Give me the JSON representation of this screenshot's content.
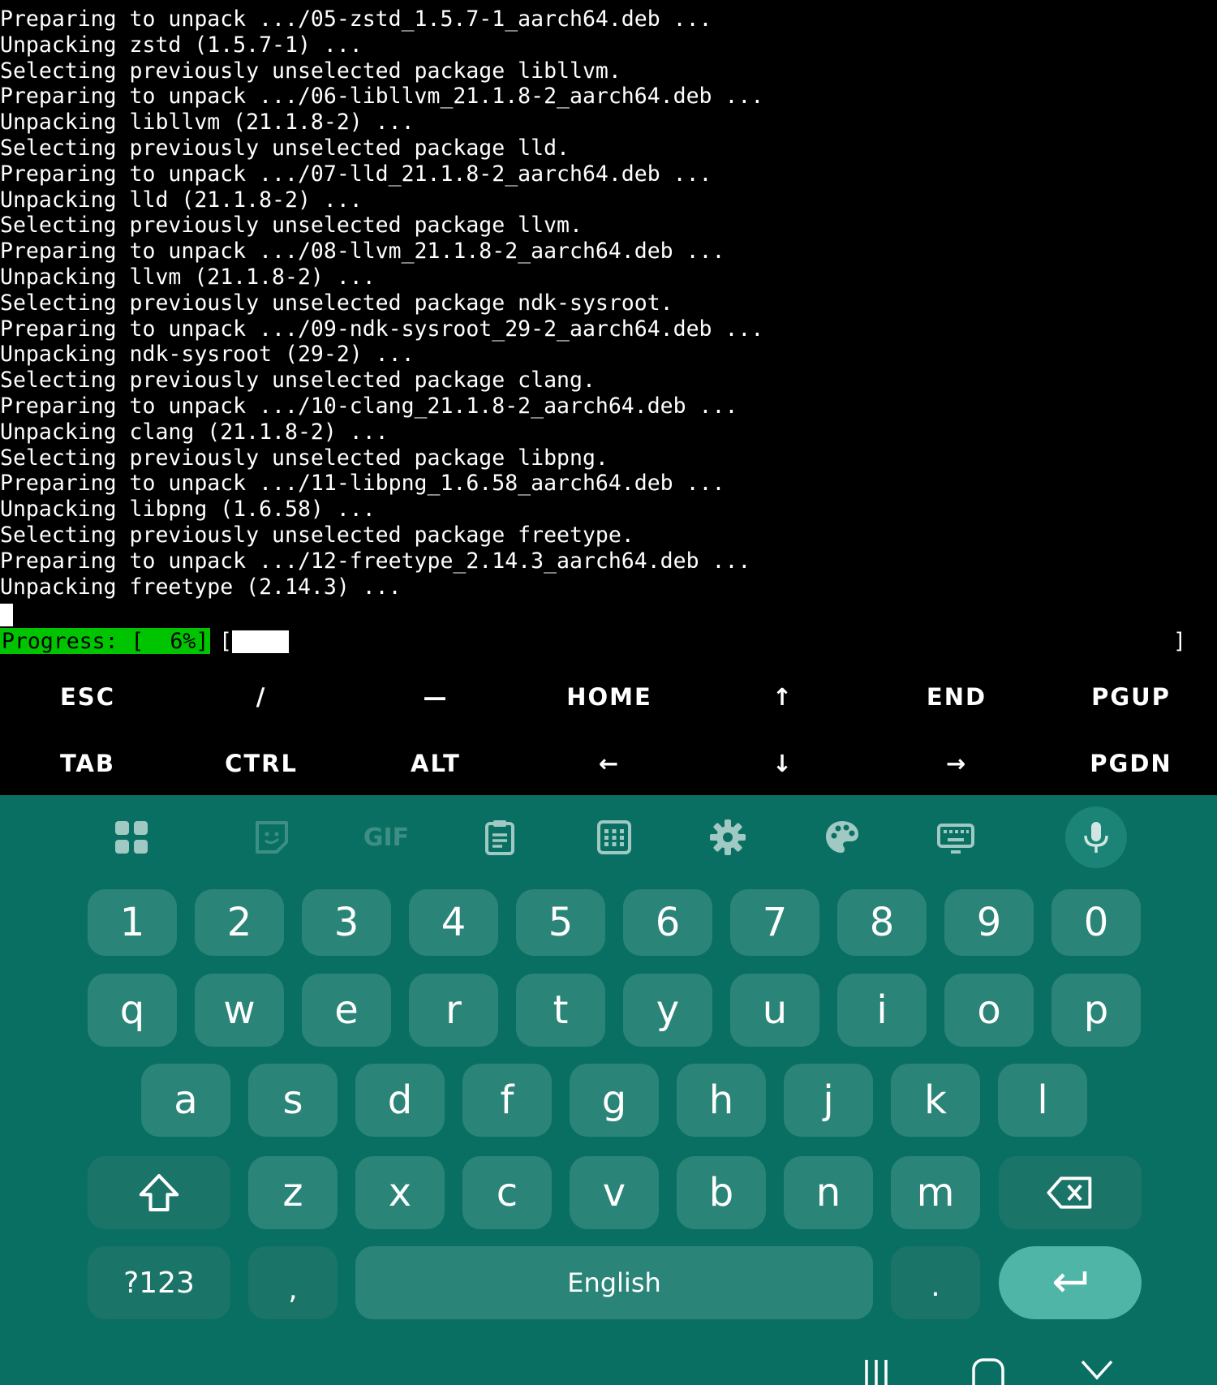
{
  "terminal": {
    "lines": [
      "Preparing to unpack .../05-zstd_1.5.7-1_aarch64.deb ...",
      "Unpacking zstd (1.5.7-1) ...",
      "Selecting previously unselected package libllvm.",
      "Preparing to unpack .../06-libllvm_21.1.8-2_aarch64.deb ...",
      "Unpacking libllvm (21.1.8-2) ...",
      "Selecting previously unselected package lld.",
      "Preparing to unpack .../07-lld_21.1.8-2_aarch64.deb ...",
      "Unpacking lld (21.1.8-2) ...",
      "Selecting previously unselected package llvm.",
      "Preparing to unpack .../08-llvm_21.1.8-2_aarch64.deb ...",
      "Unpacking llvm (21.1.8-2) ...",
      "Selecting previously unselected package ndk-sysroot.",
      "Preparing to unpack .../09-ndk-sysroot_29-2_aarch64.deb ...",
      "Unpacking ndk-sysroot (29-2) ...",
      "Selecting previously unselected package clang.",
      "Preparing to unpack .../10-clang_21.1.8-2_aarch64.deb ...",
      "Unpacking clang (21.1.8-2) ...",
      "Selecting previously unselected package libpng.",
      "Preparing to unpack .../11-libpng_1.6.58_aarch64.deb ...",
      "Unpacking libpng (1.6.58) ...",
      "Selecting previously unselected package freetype.",
      "Preparing to unpack .../12-freetype_2.14.3_aarch64.deb ...",
      "Unpacking freetype (2.14.3) ..."
    ],
    "progress": {
      "label": "Progress: [  6%]",
      "open": "[",
      "close": "]",
      "percent": 6,
      "color": "#00c400"
    }
  },
  "extra_keys": {
    "row1": [
      "ESC",
      "/",
      "—",
      "HOME",
      "↑",
      "END",
      "PGUP"
    ],
    "row2": [
      "TAB",
      "CTRL",
      "ALT",
      "←",
      "↓",
      "→",
      "PGDN"
    ]
  },
  "keyboard": {
    "toolbar": [
      "apps-grid-icon",
      "sticker-icon",
      "gif-icon",
      "clipboard-icon",
      "numpad-icon",
      "gear-icon",
      "palette-icon",
      "keyboard-icon",
      "microphone-icon"
    ],
    "gif_label": "GIF",
    "numbers": [
      "1",
      "2",
      "3",
      "4",
      "5",
      "6",
      "7",
      "8",
      "9",
      "0"
    ],
    "row_q": [
      "q",
      "w",
      "e",
      "r",
      "t",
      "y",
      "u",
      "i",
      "o",
      "p"
    ],
    "row_a": [
      "a",
      "s",
      "d",
      "f",
      "g",
      "h",
      "j",
      "k",
      "l"
    ],
    "row_z": [
      "z",
      "x",
      "c",
      "v",
      "b",
      "n",
      "m"
    ],
    "symbols_label": "?123",
    "comma": ",",
    "space_label": "English",
    "period": ".",
    "colors": {
      "background": "#0a6f63",
      "key": "#2a8578",
      "enter": "#4fb5a6"
    }
  },
  "nav": [
    "recents-icon",
    "home-icon",
    "back-icon"
  ]
}
